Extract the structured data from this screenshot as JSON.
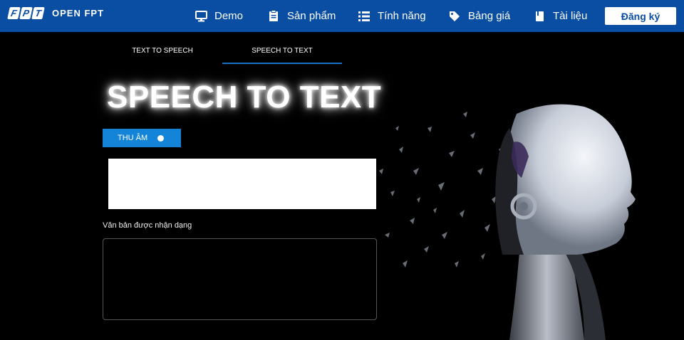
{
  "header": {
    "logo_letters": [
      "F",
      "P",
      "T"
    ],
    "brand": "OPEN FPT",
    "nav": [
      {
        "label": "Demo",
        "icon": "monitor-icon"
      },
      {
        "label": "Sản phẩm",
        "icon": "clipboard-icon"
      },
      {
        "label": "Tính năng",
        "icon": "list-icon"
      },
      {
        "label": "Bảng giá",
        "icon": "tag-icon"
      },
      {
        "label": "Tài liệu",
        "icon": "book-icon"
      }
    ],
    "signup_label": "Đăng ký"
  },
  "tabs": [
    {
      "label": "TEXT TO SPEECH",
      "active": false
    },
    {
      "label": "SPEECH TO TEXT",
      "active": true
    }
  ],
  "main": {
    "title": "SPEECH TO TEXT",
    "record_label": "THU ÂM",
    "recognized_label": "Văn bản được nhận dạng",
    "recognized_value": ""
  },
  "colors": {
    "header_bg": "#0a4ea3",
    "accent": "#1384d8",
    "tab_underline": "#1a6fc7"
  }
}
